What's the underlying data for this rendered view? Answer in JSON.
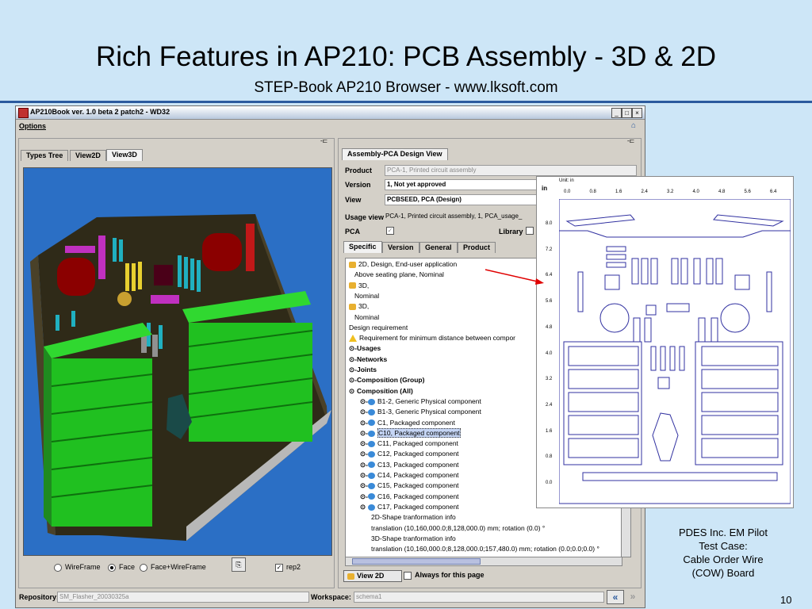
{
  "slide": {
    "title": "Rich Features in AP210: PCB Assembly - 3D & 2D",
    "subtitle": "STEP-Book AP210 Browser - www.lksoft.com",
    "caption_lines": [
      "PDES Inc. EM Pilot",
      "Test Case:",
      "Cable Order Wire",
      "(COW) Board"
    ],
    "page_number": "10",
    "rule_color": "#2b5a9e",
    "background_color": "#cde6f7"
  },
  "window": {
    "title": "AP210Book ver. 1.0 beta 2 patch2 - WD32",
    "menu": [
      "Options"
    ],
    "buttons": [
      "_",
      "□",
      "×"
    ]
  },
  "left_panel": {
    "tabs": [
      "Types Tree",
      "View2D",
      "View3D"
    ],
    "active_tab": "View3D",
    "render_modes": [
      "WireFrame",
      "Face",
      "Face+WireFrame"
    ],
    "selected_mode": "Face",
    "rep_checkbox": {
      "label": "rep2",
      "checked": true
    }
  },
  "right_panel": {
    "tab": "Assembly-PCA Design View",
    "product_label": "Product",
    "product_value": "PCA-1, Printed circuit assembly",
    "version_label": "Version",
    "version_value": "1, Not yet approved",
    "view_label": "View",
    "view_value": "PCBSEED, PCA (Design)",
    "usage_view_label": "Usage view",
    "usage_view_value": "PCA-1, Printed circuit assembly, 1, PCA_usage_",
    "pca_label": "PCA",
    "library_label": "Library",
    "subtabs": [
      "Specific",
      "Version",
      "General",
      "Product"
    ],
    "active_subtab": "Specific",
    "tree": [
      {
        "text": "2D, Design, End-user application",
        "indent": 0,
        "icon": "y"
      },
      {
        "text": "Above seating plane, Nominal",
        "indent": 1,
        "icon": ""
      },
      {
        "text": "3D,",
        "indent": 0,
        "icon": "y"
      },
      {
        "text": "Nominal",
        "indent": 1,
        "icon": ""
      },
      {
        "text": "3D,",
        "indent": 0,
        "icon": "y"
      },
      {
        "text": "Nominal",
        "indent": 1,
        "icon": ""
      },
      {
        "text": "Design requirement",
        "indent": 0,
        "icon": ""
      },
      {
        "text": "Requirement for minimum distance between compor",
        "indent": 0,
        "icon": "w"
      },
      {
        "text": "Usages",
        "indent": 0,
        "icon": "",
        "expander": "o-",
        "bold": true
      },
      {
        "text": "Networks",
        "indent": 0,
        "icon": "",
        "expander": "o-",
        "bold": true
      },
      {
        "text": "Joints",
        "indent": 0,
        "icon": "",
        "expander": "o-",
        "bold": true
      },
      {
        "text": "Composition (Group)",
        "indent": 0,
        "icon": "",
        "expander": "o-",
        "bold": true
      },
      {
        "text": "Composition (All)",
        "indent": 0,
        "icon": "",
        "expander": "o",
        "bold": true
      },
      {
        "text": "B1-2, Generic Physical component",
        "indent": 2,
        "icon": "c",
        "expander": "o-"
      },
      {
        "text": "B1-3, Generic Physical component",
        "indent": 2,
        "icon": "c",
        "expander": "o-"
      },
      {
        "text": "C1, Packaged component",
        "indent": 2,
        "icon": "c",
        "expander": "o-"
      },
      {
        "text": "C10, Packaged component",
        "indent": 2,
        "icon": "c",
        "expander": "o-",
        "selected": true
      },
      {
        "text": "C11, Packaged component",
        "indent": 2,
        "icon": "c",
        "expander": "o-"
      },
      {
        "text": "C12, Packaged component",
        "indent": 2,
        "icon": "c",
        "expander": "o-"
      },
      {
        "text": "C13, Packaged component",
        "indent": 2,
        "icon": "c",
        "expander": "o-"
      },
      {
        "text": "C14, Packaged component",
        "indent": 2,
        "icon": "c",
        "expander": "o-"
      },
      {
        "text": "C15, Packaged component",
        "indent": 2,
        "icon": "c",
        "expander": "o-"
      },
      {
        "text": "C16, Packaged component",
        "indent": 2,
        "icon": "c",
        "expander": "o-"
      },
      {
        "text": "C17, Packaged component",
        "indent": 2,
        "icon": "c",
        "expander": "o"
      },
      {
        "text": "2D-Shape tranformation info",
        "indent": 4,
        "icon": ""
      },
      {
        "text": "translation (10,160,000.0;8,128,000.0) mm; rotation (0.0) °",
        "indent": 4,
        "icon": ""
      },
      {
        "text": "3D-Shape tranformation info",
        "indent": 4,
        "icon": ""
      },
      {
        "text": "translation (10,160,000.0;8,128,000.0;157,480.0) mm; rotation (0.0;0.0;0.0) °",
        "indent": 4,
        "icon": ""
      }
    ],
    "view2d_button": "View 2D",
    "always_for_page": "Always for this page"
  },
  "status_bar": {
    "repository_label": "Repository:",
    "repository_value": "SM_Flasher_20030325a",
    "workspace_label": "Workspace:",
    "workspace_value": "schema1"
  },
  "drawing": {
    "unit_label": "Unit: in",
    "unit": "in",
    "x_ticks": [
      "0.0",
      "0.8",
      "1.6",
      "2.4",
      "3.2",
      "4.0",
      "4.8",
      "5.6",
      "6.4"
    ],
    "y_ticks": [
      "8.0",
      "7.2",
      "6.4",
      "5.6",
      "4.8",
      "4.0",
      "3.2",
      "2.4",
      "1.6",
      "0.8",
      "0.0"
    ]
  }
}
